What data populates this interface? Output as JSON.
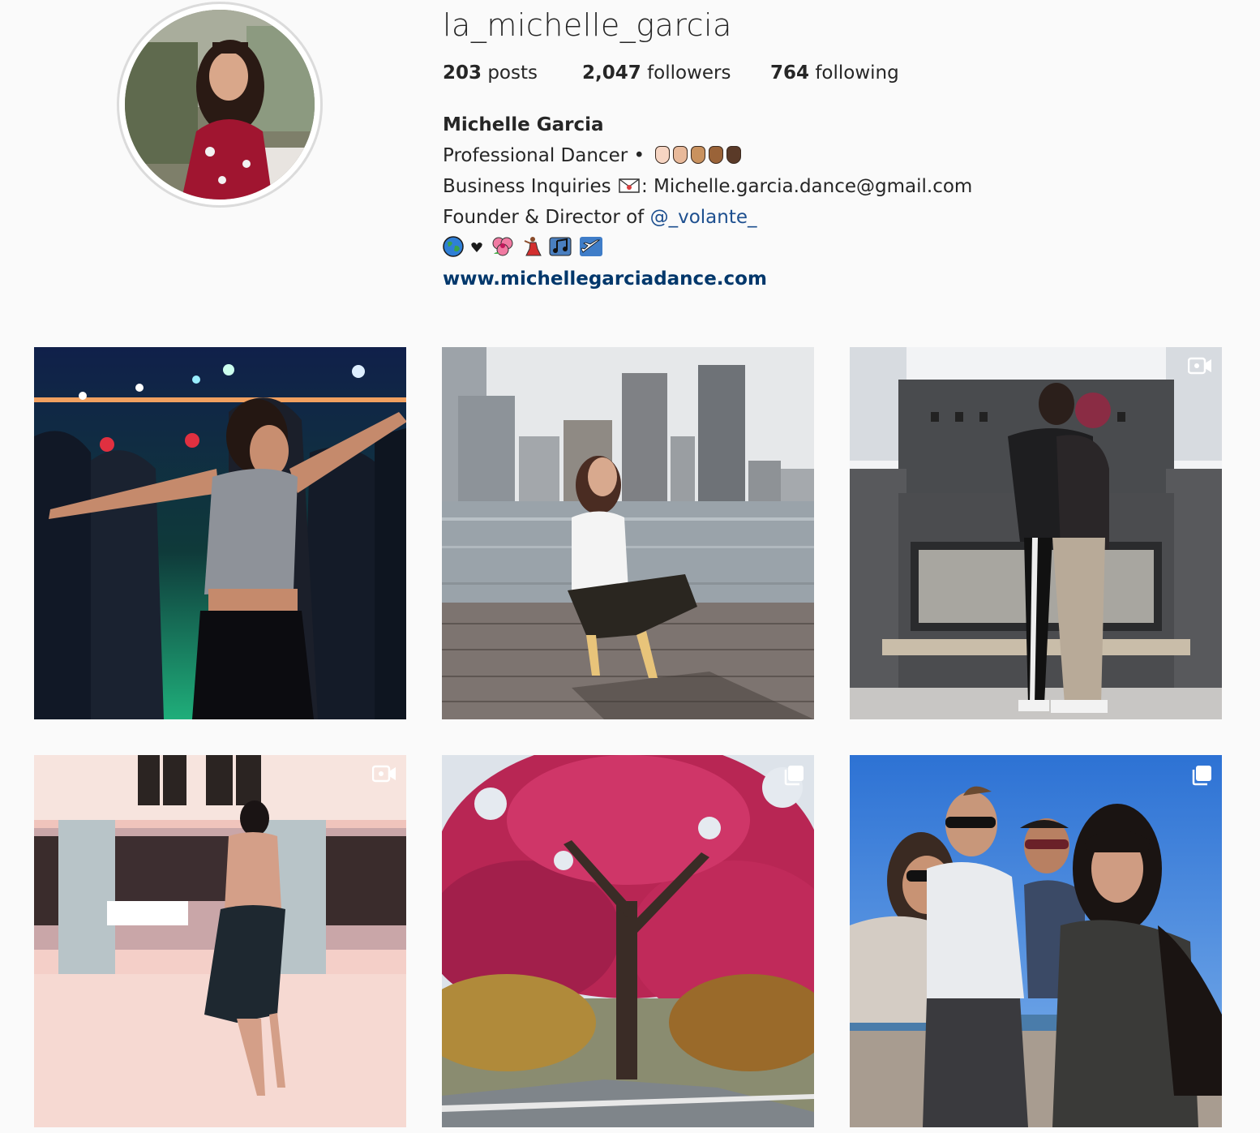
{
  "profile": {
    "username": "la_michelle_garcia",
    "stats": {
      "posts_count": "203",
      "posts_label": " posts",
      "followers_count": "2,047",
      "followers_label": " followers",
      "following_count": "764",
      "following_label": " following"
    },
    "bio": {
      "name": "Michelle Garcia",
      "line1": "Professional Dancer •",
      "line2_prefix": "Business Inquiries",
      "line2_suffix": ": Michelle.garcia.dance@gmail.com",
      "line3_prefix": "Founder & Director of ",
      "line3_mention": "@_volante_",
      "emoji_icons": [
        "globe-icon",
        "heart-icon",
        "hibiscus-icon",
        "dancer-icon",
        "music-notes-icon",
        "airplane-icon"
      ],
      "website": "www.michellegarciadance.com"
    }
  },
  "posts": [
    {
      "scene": "dance-club-photo",
      "badge": "none"
    },
    {
      "scene": "harbor-skyline-photo",
      "badge": "none"
    },
    {
      "scene": "couple-hug-photo",
      "badge": "video"
    },
    {
      "scene": "dance-studio-photo",
      "badge": "video"
    },
    {
      "scene": "red-tree-photo",
      "badge": "carousel"
    },
    {
      "scene": "group-selfie-photo",
      "badge": "carousel"
    }
  ],
  "colors": {
    "background": "#fafafa",
    "text": "#262626",
    "link": "#00376b",
    "border": "#dbdbdb"
  }
}
